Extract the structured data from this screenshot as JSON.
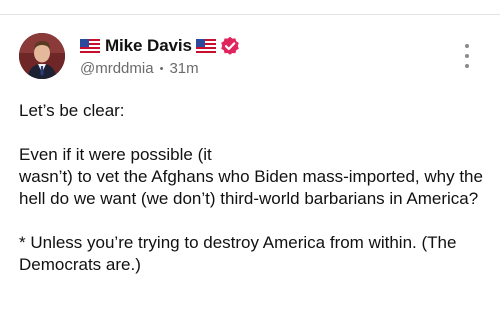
{
  "post": {
    "author": {
      "display_name": "Mike Davis",
      "handle": "@mrddmia",
      "separator": "•",
      "time_ago": "31m",
      "name_prefix_emoji": "us-flag",
      "name_suffix_emoji": "us-flag",
      "verified_icon": "verified-badge-icon",
      "verified_color": "#e0245e"
    },
    "paragraphs": [
      "Let’s be clear:",
      "Even if it were possible (it\nwasn’t) to vet the Afghans who Biden mass-imported, why the hell do we want (we don’t) third-world barbarians in America?",
      "* Unless you’re trying to destroy America from within. (The Democrats are.)"
    ],
    "menu_icon": "more-vertical-icon"
  }
}
